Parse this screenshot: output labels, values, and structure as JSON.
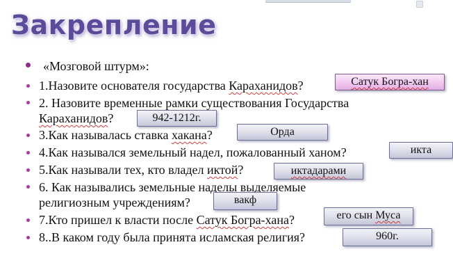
{
  "title": "Закрепление",
  "items": [
    {
      "text": "«Мозговой штурм»:"
    },
    {
      "pre": "1.Назовите основателя государства ",
      "sq": "Караханидов",
      "post": "?"
    },
    {
      "text": "2. Назовите временные рамки существования Государства"
    },
    {
      "pre": "",
      "sq": "Караханидов",
      "post": "?"
    },
    {
      "pre": "3.Как называлась ставка ",
      "sq": "хакана",
      "post": "?"
    },
    {
      "text": "4.Как назывался земельный надел, пожалованный ханом?"
    },
    {
      "pre": "5.Как называли тех, кто владел ",
      "sq": "иктой",
      "post": "?"
    },
    {
      "text": "6. Как назывались земельные наделы выделяемые"
    },
    {
      "text": "религиозным учреждениям?"
    },
    {
      "pre": "7.Кто пришел к власти после ",
      "sq": "Сатук Богра-хана",
      "post": "?"
    },
    {
      "text": "8..В каком году была принята исламская религия?"
    }
  ],
  "answers": {
    "a1": {
      "pre": "",
      "sq": "Сатук Богра-хан",
      "post": ""
    },
    "a2": "942-1212г.",
    "a3": "Орда",
    "a4": "икта",
    "a5": {
      "pre": "",
      "sq": "иктадарами",
      "post": ""
    },
    "a6": "вакф",
    "a7": {
      "pre": "его сын ",
      "sq": "Муса",
      "post": ""
    },
    "a8": "960г."
  }
}
